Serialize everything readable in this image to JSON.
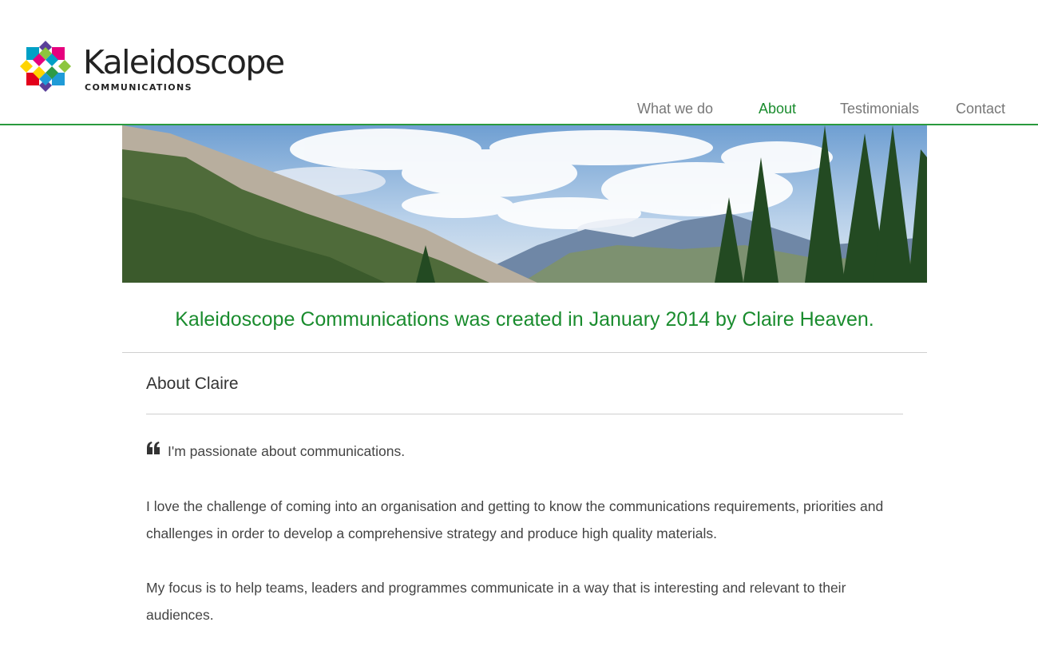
{
  "brand": {
    "name": "Kaleidoscope",
    "subtitle": "COMMUNICATIONS",
    "colors": [
      "#e6007e",
      "#8dc63f",
      "#00a0c6",
      "#ffd400",
      "#e3001b",
      "#1f9bd7",
      "#2e9a46",
      "#5a3f99"
    ]
  },
  "nav": {
    "items": [
      {
        "label": "What we do",
        "active": false
      },
      {
        "label": "About",
        "active": true
      },
      {
        "label": "Testimonials",
        "active": false
      },
      {
        "label": "Contact",
        "active": false
      }
    ],
    "accent_color": "#1a8c2e"
  },
  "hero": {
    "icon": "mountain-landscape-image"
  },
  "main": {
    "tagline": "Kaleidoscope Communications was created in January 2014 by Claire Heaven.",
    "section_title": "About Claire",
    "quote": "I'm passionate about communications.",
    "paragraphs": [
      "I love the challenge of coming into an organisation and getting to know the communications requirements, priorities and challenges in order to develop a comprehensive strategy and produce high quality materials.",
      "My focus is to help teams, leaders and programmes communicate in a way that is interesting and relevant to their audiences."
    ]
  }
}
